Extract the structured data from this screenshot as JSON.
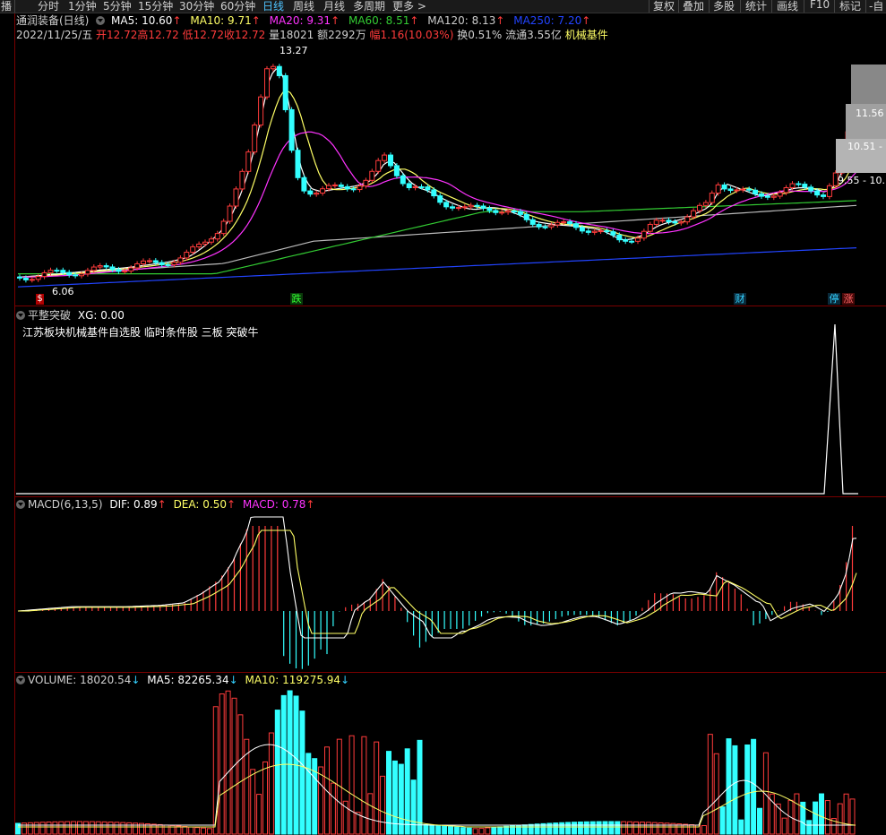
{
  "toolbar": {
    "left_edge": "播",
    "tabs": [
      "分时",
      "1分钟",
      "5分钟",
      "15分钟",
      "30分钟",
      "60分钟",
      "日线",
      "周线",
      "月线",
      "多周期",
      "更多 >"
    ],
    "active_tab": "日线",
    "right_buttons": [
      "复权",
      "叠加",
      "多股",
      "统计",
      "画线",
      "F10",
      "标记",
      "-自"
    ]
  },
  "main": {
    "title": "通润装备(日线)",
    "ma5": "MA5: 10.60",
    "ma10": "MA10: 9.71",
    "ma20": "MA20: 9.31",
    "ma60": "MA60: 8.51",
    "ma120": "MA120: 8.13",
    "ma250": "MA250: 7.20",
    "date": "2022/11/25/五",
    "open": "开12.72",
    "high": "高12.72",
    "low": "低12.72",
    "close": "收12.72",
    "vol": "量18021",
    "amount": "额2292万",
    "change": "幅1.16(10.03%)",
    "turnover": "换0.51%",
    "float": "流通3.55亿",
    "sector": "机械基件",
    "high_mark": "13.27",
    "low_mark": "6.06",
    "price_labels": [
      "11.56",
      "10.51 -",
      "9.55 - 10."
    ],
    "events": [
      "$",
      "跌",
      "财",
      "停",
      "涨"
    ],
    "arrows": "↑"
  },
  "indicator": {
    "title": "平整突破",
    "xg": "XG: 0.00",
    "text": "江苏板块机械基件自选股 临时条件股 三板 突破牛"
  },
  "macd": {
    "title": "MACD(6,13,5)",
    "dif": "DIF: 0.89",
    "dea": "DEA: 0.50",
    "macd": "MACD: 0.78"
  },
  "volume": {
    "title": "VOLUME: 18020.54",
    "ma5": "MA5: 82265.34",
    "ma10": "MA10: 119275.94"
  },
  "colors": {
    "up": "#ff3b3b",
    "down": "#33ffff",
    "ma5": "#ffffff",
    "ma10": "#ffff66",
    "ma20": "#ff33ff",
    "ma60": "#33cc33",
    "ma120": "#cccccc",
    "ma250": "#2244ff"
  }
}
